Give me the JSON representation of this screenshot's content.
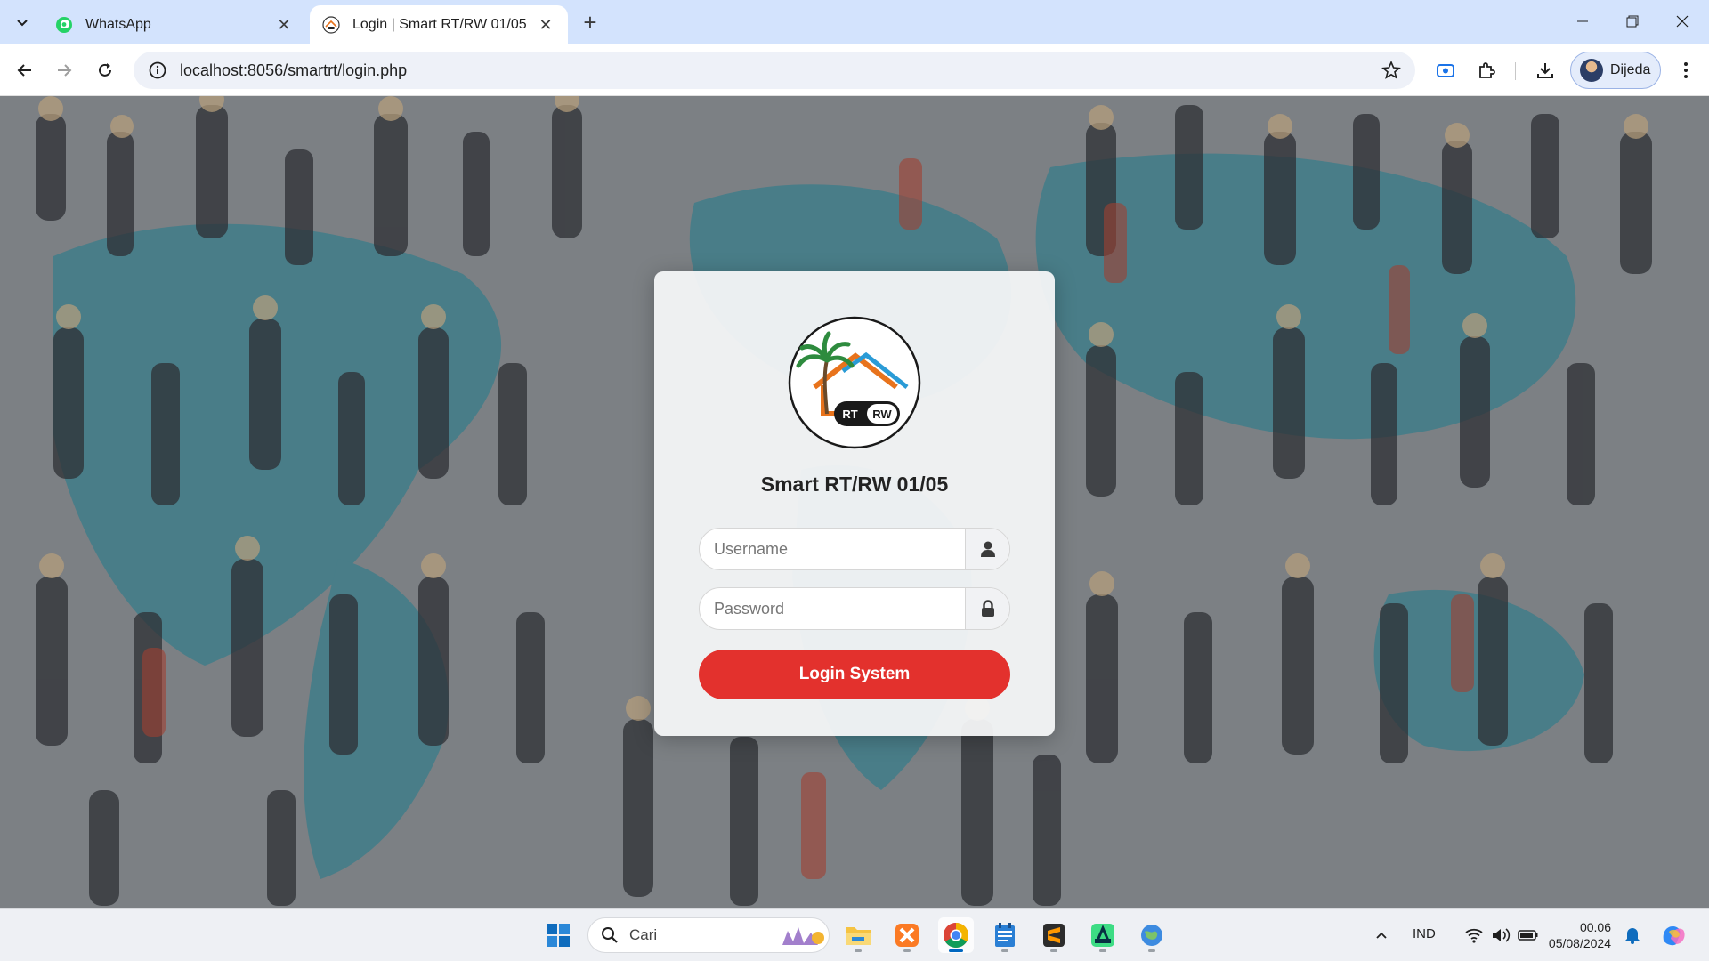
{
  "browser": {
    "tabs": [
      {
        "title": "WhatsApp",
        "icon": "whatsapp-icon",
        "active": false
      },
      {
        "title": "Login | Smart RT/RW 01/05",
        "icon": "site-favicon",
        "active": true
      }
    ],
    "url": "localhost:8056/smartrt/login.php",
    "profile_name": "Dijeda"
  },
  "login": {
    "logo_text_rt": "RT",
    "logo_text_rw": "RW",
    "app_title": "Smart RT/RW 01/05",
    "username_placeholder": "Username",
    "username_value": "",
    "password_placeholder": "Password",
    "password_value": "",
    "submit_label": "Login System"
  },
  "taskbar": {
    "search_placeholder": "Cari",
    "language": "IND",
    "time": "00.06",
    "date": "05/08/2024",
    "pinned_apps": [
      "windows-start-icon",
      "file-explorer-icon",
      "xampp-icon",
      "chrome-icon",
      "notepad-icon",
      "sublime-text-icon",
      "android-studio-icon",
      "vpn-globe-icon"
    ]
  },
  "colors": {
    "login_button": "#e3312d",
    "tab_strip": "#d3e3fd",
    "logo_orange": "#e8731c",
    "logo_blue": "#2a9bd6"
  }
}
